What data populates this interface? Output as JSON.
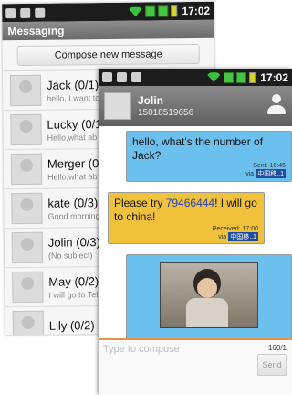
{
  "status_bar": {
    "time": "17:02"
  },
  "messaging": {
    "title": "Messaging",
    "compose_label": "Compose new message",
    "conversations": [
      {
        "name": "Jack (0/1)",
        "preview": "hello, I want to"
      },
      {
        "name": "Lucky (0/1",
        "preview": "Hello,what ab"
      },
      {
        "name": "Merger (0/",
        "preview": "Hello,what ab"
      },
      {
        "name": "kate (0/3)",
        "preview": "Good morning"
      },
      {
        "name": "Jolin (0/3)",
        "preview": "(No subject)"
      },
      {
        "name": "May (0/2)",
        "preview": "I will go to Tel"
      },
      {
        "name": "Lily (0/2)",
        "preview": ""
      }
    ]
  },
  "conversation": {
    "contact_name": "Jolin",
    "contact_number": "15018519656",
    "messages": [
      {
        "text": "hello, what's the number of Jack?",
        "status": "Sent: 16:45",
        "via_prefix": "via",
        "via_tag": "中国移..1"
      },
      {
        "text_before": "Please try ",
        "link": "79466444",
        "text_after": "! I will go to china!",
        "status": "Received: 17:00",
        "via_prefix": "via",
        "via_tag": "中国移..1"
      }
    ],
    "compose_placeholder": "Type to compose",
    "char_counter": "160/1",
    "send_label": "Send"
  }
}
